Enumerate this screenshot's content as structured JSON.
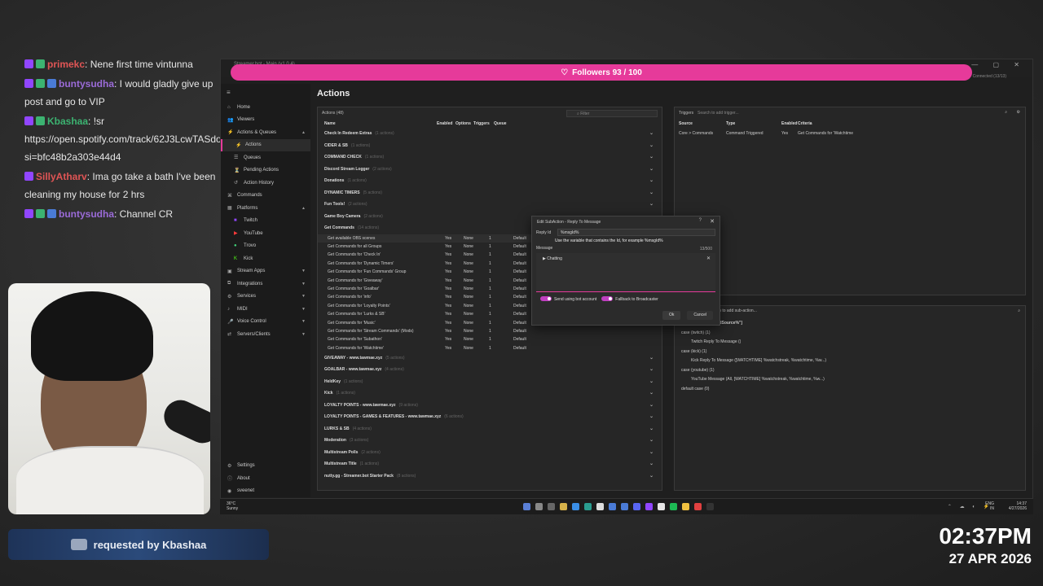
{
  "chat": {
    "messages": [
      {
        "user": "primekc",
        "text": ": Nene first time vintunna",
        "color": "#e05555",
        "badges": [
          "b-purple",
          "b-green"
        ]
      },
      {
        "user": "buntysudha",
        "text": ": I would gladly give up post and go to VIP",
        "color": "#9b6bd8",
        "badges": [
          "b-purple",
          "b-green",
          "b-blue"
        ]
      },
      {
        "user": "Kbashaa",
        "text": ": !sr https://open.spotify.com/track/62J3LcwTASdo624WsF3L6k?si=bfc48b2a303e44d4",
        "color": "#3cb371",
        "badges": [
          "b-purple",
          "b-green"
        ]
      },
      {
        "user": "SillyAtharv",
        "text": ": Ima go take a bath I've been cleaning my house for 2 hrs",
        "color": "#e05555",
        "badges": [
          "b-purple"
        ]
      },
      {
        "user": "buntysudha",
        "text": ": Channel CR",
        "color": "#9b6bd8",
        "badges": [
          "b-purple",
          "b-green",
          "b-blue"
        ]
      }
    ]
  },
  "request": {
    "label": "requested by Kbashaa",
    "icon": "car-icon"
  },
  "clock": {
    "time": "02:37PM",
    "date": "27 APR 2026"
  },
  "window": {
    "title": "Streamer.bot - Main (v1.0.4)",
    "followers": "Followers 93 / 100",
    "connected": "Connected (13/13)"
  },
  "sidebar": {
    "items": [
      {
        "label": "Home",
        "icon": "⌂",
        "sub": false
      },
      {
        "label": "Viewers",
        "icon": "👥",
        "sub": false
      },
      {
        "label": "Actions & Queues",
        "icon": "⚡",
        "sub": false,
        "chev": "▲"
      },
      {
        "label": "Actions",
        "icon": "⚡",
        "sub": true,
        "active": true
      },
      {
        "label": "Queues",
        "icon": "☰",
        "sub": true
      },
      {
        "label": "Pending Actions",
        "icon": "⏳",
        "sub": true
      },
      {
        "label": "Action History",
        "icon": "↺",
        "sub": true
      },
      {
        "label": "Commands",
        "icon": "⌘",
        "sub": false
      },
      {
        "label": "Platforms",
        "icon": "▦",
        "sub": false,
        "chev": "▲"
      },
      {
        "label": "Twitch",
        "icon": "■",
        "sub": true,
        "cls": "tw"
      },
      {
        "label": "YouTube",
        "icon": "▶",
        "sub": true,
        "cls": "yt"
      },
      {
        "label": "Trovo",
        "icon": "●",
        "sub": true,
        "cls": "tr"
      },
      {
        "label": "Kick",
        "icon": "K",
        "sub": true,
        "cls": "kk"
      },
      {
        "label": "Stream Apps",
        "icon": "▣",
        "sub": false,
        "chev": "▼"
      },
      {
        "label": "Integrations",
        "icon": "⧉",
        "sub": false,
        "chev": "▼"
      },
      {
        "label": "Services",
        "icon": "⚙",
        "sub": false,
        "chev": "▼"
      },
      {
        "label": "MIDI",
        "icon": "♪",
        "sub": false,
        "chev": "▼"
      },
      {
        "label": "Voice Control",
        "icon": "🎤",
        "sub": false,
        "chev": "▼"
      },
      {
        "label": "Servers/Clients",
        "icon": "⇄",
        "sub": false,
        "chev": "▼"
      }
    ],
    "bottom": [
      {
        "label": "Settings",
        "icon": "⚙"
      },
      {
        "label": "About",
        "icon": "ⓘ"
      },
      {
        "label": "sveenet",
        "icon": "◉"
      }
    ]
  },
  "actions": {
    "heading": "Actions",
    "count_label": "Actions (48)",
    "filter_placeholder": "Filter",
    "columns": [
      "Name",
      "Enabled",
      "Options",
      "Triggers",
      "Queue"
    ],
    "groups_top": [
      {
        "name": "Check In Redeem Extras",
        "cnt": "(1 actions)"
      },
      {
        "name": "CIDER & SB",
        "cnt": "(1 actions)"
      },
      {
        "name": "COMMAND CHECK",
        "cnt": "(1 actions)"
      },
      {
        "name": "Discord Stream Logger",
        "cnt": "(2 actions)"
      },
      {
        "name": "Donations",
        "cnt": "(1 actions)"
      },
      {
        "name": "DYNAMIC TIMERS",
        "cnt": "(5 actions)"
      },
      {
        "name": "Fun Tools!",
        "cnt": "(2 actions)"
      },
      {
        "name": "Game Boy Camera",
        "cnt": "(2 actions)"
      },
      {
        "name": "Get Commands",
        "cnt": "(14 actions)"
      }
    ],
    "rows": [
      {
        "name": "Get available OBS scenes",
        "enabled": "Yes",
        "options": "None",
        "triggers": "1",
        "queue": "Default"
      },
      {
        "name": "Get Commands for all Groups",
        "enabled": "Yes",
        "options": "None",
        "triggers": "1",
        "queue": "Default"
      },
      {
        "name": "Get Commands for 'Check In'",
        "enabled": "Yes",
        "options": "None",
        "triggers": "1",
        "queue": "Default"
      },
      {
        "name": "Get Commands for 'Dynamic Timers'",
        "enabled": "Yes",
        "options": "None",
        "triggers": "1",
        "queue": "Default"
      },
      {
        "name": "Get Commands for 'Fun Commands' Group",
        "enabled": "Yes",
        "options": "None",
        "triggers": "1",
        "queue": "Default"
      },
      {
        "name": "Get Commands for 'Giveaway'",
        "enabled": "Yes",
        "options": "None",
        "triggers": "1",
        "queue": "Default"
      },
      {
        "name": "Get Commands for 'Goalbar'",
        "enabled": "Yes",
        "options": "None",
        "triggers": "1",
        "queue": "Default"
      },
      {
        "name": "Get Commands for 'info'",
        "enabled": "Yes",
        "options": "None",
        "triggers": "1",
        "queue": "Default"
      },
      {
        "name": "Get Commands for 'Loyalty Points'",
        "enabled": "Yes",
        "options": "None",
        "triggers": "1",
        "queue": "Default"
      },
      {
        "name": "Get Commands for 'Lurks & SB'",
        "enabled": "Yes",
        "options": "None",
        "triggers": "1",
        "queue": "Default"
      },
      {
        "name": "Get Commands for 'Music'",
        "enabled": "Yes",
        "options": "None",
        "triggers": "1",
        "queue": "Default"
      },
      {
        "name": "Get Commands for 'Stream Commands' (Mods)",
        "enabled": "Yes",
        "options": "None",
        "triggers": "1",
        "queue": "Default"
      },
      {
        "name": "Get Commands for 'Subathon'",
        "enabled": "Yes",
        "options": "None",
        "triggers": "1",
        "queue": "Default"
      },
      {
        "name": "Get Commands for 'Watchtime'",
        "enabled": "Yes",
        "options": "None",
        "triggers": "1",
        "queue": "Default"
      }
    ],
    "groups_bottom": [
      {
        "name": "GIVEAWAY - www.tawmae.xyz",
        "cnt": "(5 actions)"
      },
      {
        "name": "GOALBAR - www.tawmae.xyz",
        "cnt": "(4 actions)"
      },
      {
        "name": "HeldKey",
        "cnt": "(1 actions)"
      },
      {
        "name": "Kick",
        "cnt": "(1 actions)"
      },
      {
        "name": "LOYALTY POINTS - www.tawmae.xyz",
        "cnt": "(9 actions)"
      },
      {
        "name": "LOYALTY POINTS - GAMES & FEATURES - www.tawmae.xyz",
        "cnt": "(6 actions)"
      },
      {
        "name": "LURKS & SB",
        "cnt": "(4 actions)"
      },
      {
        "name": "Moderation",
        "cnt": "(3 actions)"
      },
      {
        "name": "Multistream Polls",
        "cnt": "(2 actions)"
      },
      {
        "name": "Multistream Title",
        "cnt": "(1 actions)"
      },
      {
        "name": "nutty.gg - Streamer.bot Starter Pack",
        "cnt": "(8 actions)"
      }
    ]
  },
  "triggers": {
    "title": "Triggers",
    "search_placeholder": "Search to add trigger...",
    "columns": [
      "Source",
      "Type",
      "Enabled",
      "Criteria"
    ],
    "rows": [
      {
        "source": "Core > Commands",
        "type": "Command Triggered",
        "enabled": "Yes",
        "criteria": "Get Commands for 'Watchtime"
      }
    ]
  },
  "subactions": {
    "search_placeholder": "...h to add sub-action...",
    "lines": [
      {
        "text": "...mandSource%\"]",
        "indent": 40,
        "bold": true
      },
      {
        "text": "case (twitch) (1)",
        "indent": 8,
        "bold": false
      },
      {
        "text": "Twitch Reply To Message ()",
        "indent": 20,
        "bold": false
      },
      {
        "text": "case (kick) (1)",
        "indent": 8,
        "bold": false
      },
      {
        "text": "Kick Reply To Message ([WATCHTIME] %watchstreak, %watchtime, %w...)",
        "indent": 20,
        "bold": false
      },
      {
        "text": "case (youtube) (1)",
        "indent": 8,
        "bold": false
      },
      {
        "text": "YouTube Message (All, [WATCHTIME] %watchstreak, %watchtime, %w...)",
        "indent": 20,
        "bold": false
      },
      {
        "text": "default case (0)",
        "indent": 8,
        "bold": false
      }
    ]
  },
  "dialog": {
    "title": "Edit SubAction - Reply To Message",
    "reply_label": "Reply Id",
    "reply_value": "%msgId%",
    "hint": "Use the variable that contains the Id, for example %msgId%",
    "message_label": "Message",
    "counter": "13/500",
    "message_value": "▶ Chatting ",
    "toggle1": "Send using bot account",
    "toggle2": "Fallback to Broadcaster",
    "ok": "Ok",
    "cancel": "Cancel"
  },
  "taskbar": {
    "temp": "36°C",
    "weather": "Sunny",
    "lang1": "ENG",
    "lang2": "IN",
    "time": "14:37",
    "date": "4/27/2026"
  }
}
